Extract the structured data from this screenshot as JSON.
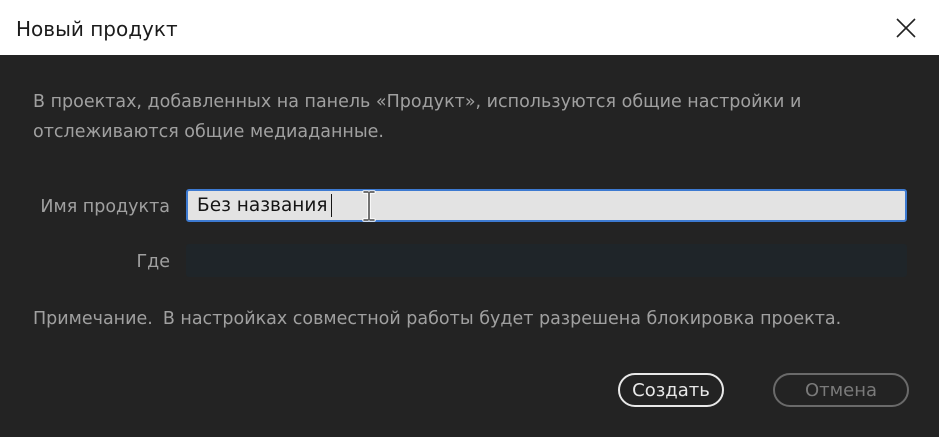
{
  "dialog": {
    "title": "Новый продукт",
    "close_icon": "close-icon",
    "description": "В проектах, добавленных на панель «Продукт», используются общие настройки и отслеживаются общие медиаданные.",
    "fields": {
      "name_label": "Имя продукта",
      "name_value": "Без названия",
      "where_label": "Где",
      "where_value": ""
    },
    "note_label": "Примечание.",
    "note_text": "В настройках совместной работы будет разрешена блокировка проекта.",
    "buttons": {
      "create": "Создать",
      "cancel": "Отмена"
    }
  },
  "colors": {
    "accent": "#3d7ad1",
    "background": "#232323",
    "titlebar": "#ffffff"
  }
}
